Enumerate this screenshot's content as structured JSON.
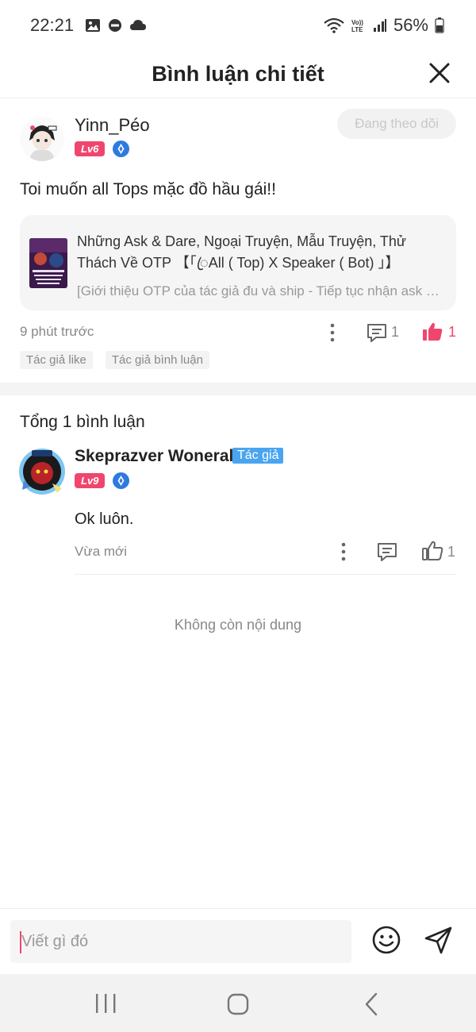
{
  "status_bar": {
    "time": "22:21",
    "battery": "56%",
    "volte_label": "VoLTE",
    "icons": [
      "gallery-icon",
      "dnd-icon",
      "cloud-icon",
      "wifi-icon",
      "signal-icon",
      "battery-icon"
    ]
  },
  "header": {
    "title": "Bình luận chi tiết",
    "close_icon": "close-icon"
  },
  "main_comment": {
    "username": "Yinn_Péo",
    "level": "Lv6",
    "follow_label": "Đang theo dõi",
    "text": "Toi muốn all Tops mặc đồ hầu gái!!",
    "story": {
      "title": "Những Ask & Dare, Ngoại Truyện, Mẫu Truyện, Thử Thách Về OTP 【「ꦿAll ( Top) X Speaker ( Bot) 」】",
      "description": "[Giới thiệu OTP của tác giả đu và ship - Tiếp tục nhận ask & dare]"
    },
    "time": "9 phút trước",
    "comment_count": "1",
    "like_count": "1",
    "tags": [
      "Tác giả like",
      "Tác giả bình luận"
    ]
  },
  "replies_section": {
    "total_label": "Tổng 1 bình luận",
    "replies": [
      {
        "username": "Skeprazver Woneral",
        "author_badge": "Tác giả",
        "level": "Lv9",
        "text": "Ok luôn.",
        "time": "Vừa mới",
        "like_count": "1"
      }
    ],
    "end_text": "Không còn nội dung"
  },
  "input_bar": {
    "placeholder": "Viết gì đó",
    "value": ""
  },
  "colors": {
    "accent": "#f0466e",
    "author_badge": "#4aa5f0",
    "vip_badge": "#2e7bdf",
    "muted_text": "#888888"
  }
}
